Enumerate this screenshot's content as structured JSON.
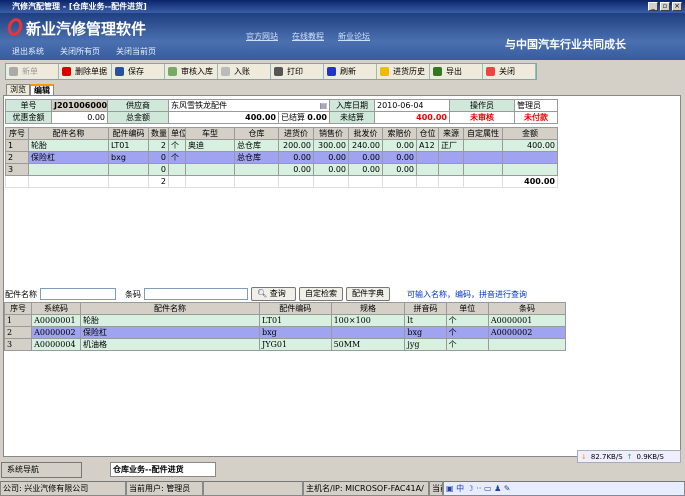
{
  "window": {
    "title": "汽修汽配管理 - [仓库业务--配件进货]"
  },
  "banner": {
    "brand": "新业汽修管理软件",
    "links": [
      "官方网站",
      "在线教程",
      "新业论坛"
    ],
    "nav": [
      "退出系统",
      "关闭所有页",
      "关闭当前页"
    ],
    "slogan": "与中国汽车行业共同成长"
  },
  "toolbar": [
    {
      "label": "新单",
      "color": "#aaa"
    },
    {
      "label": "删除单据",
      "color": "#d00"
    },
    {
      "label": "保存",
      "color": "#2a4fa0"
    },
    {
      "label": "审核入库",
      "color": "#7a6"
    },
    {
      "label": "入账",
      "color": "#bbb"
    },
    {
      "label": "打印",
      "color": "#555"
    },
    {
      "label": "刷新",
      "color": "#23c"
    },
    {
      "label": "进货历史",
      "color": "#eb0"
    },
    {
      "label": "导出",
      "color": "#372"
    },
    {
      "label": "关闭",
      "color": "#e44"
    }
  ],
  "tabs": [
    "浏览",
    "编辑"
  ],
  "form": {
    "order_no_label": "单号",
    "order_no": "J2010060001",
    "supplier_label": "供应商",
    "supplier": "东风雪铁龙配件",
    "date_label": "入库日期",
    "date": "2010-06-04",
    "operator_label": "操作员",
    "operator": "管理员",
    "discount_label": "优惠金额",
    "discount": "0.00",
    "total_label": "总金额",
    "total": "400.00",
    "settled_label": "已结算",
    "settled": "0.00",
    "unsettled_label": "未结算",
    "unsettled": "400.00",
    "audit_status": "未审核",
    "pay_status": "未付款"
  },
  "grid": {
    "columns": [
      "序号",
      "配件名称",
      "配件编码",
      "数量",
      "单位",
      "车型",
      "仓库",
      "进货价",
      "销售价",
      "批发价",
      "索赔价",
      "仓位",
      "来源",
      "自定属性",
      "金额"
    ],
    "rows": [
      [
        "1",
        "轮胎",
        "LT01",
        "2",
        "个",
        "奥迪",
        "总仓库",
        "200.00",
        "300.00",
        "240.00",
        "0.00",
        "A12",
        "正厂",
        "",
        "400.00"
      ],
      [
        "2",
        "保险杠",
        "bxg",
        "0",
        "个",
        "",
        "总仓库",
        "0.00",
        "0.00",
        "0.00",
        "0.00",
        "",
        "",
        "",
        ""
      ],
      [
        "3",
        "",
        "",
        "0",
        "",
        "",
        "",
        "0.00",
        "0.00",
        "0.00",
        "0.00",
        "",
        "",
        "",
        ""
      ]
    ],
    "totals": {
      "qty": "2",
      "amount": "400.00"
    }
  },
  "search": {
    "name_label": "配件名称",
    "name_value": "",
    "barcode_label": "条码",
    "barcode_value": "",
    "query": "查询",
    "custom": "自定检索",
    "dict": "配件字典",
    "hint": "可输入名称，编码，拼音进行查询"
  },
  "parts": {
    "columns": [
      "序号",
      "系统码",
      "配件名称",
      "配件编码",
      "规格",
      "拼音码",
      "单位",
      "条码"
    ],
    "rows": [
      [
        "1",
        "A0000001",
        "轮胎",
        "LT01",
        "100×100",
        "lt",
        "个",
        "A0000001"
      ],
      [
        "2",
        "A0000002",
        "保险杠",
        "bxg",
        "",
        "bxg",
        "个",
        "A0000002"
      ],
      [
        "3",
        "A0000004",
        "机油格",
        "JYG01",
        "50MM",
        "jyg",
        "个",
        ""
      ]
    ]
  },
  "bottom": {
    "nav_button": "系统导航",
    "current_tab": "仓库业务--配件进货",
    "down_speed": "82.7KB/S",
    "up_speed": "0.9KB/S"
  },
  "status": {
    "company": "公司: 兴业汽修有限公司",
    "user": "当前用户: 管理员",
    "host": "主机名/IP: MICROSOF-FAC41A/",
    "extra": "当前"
  }
}
